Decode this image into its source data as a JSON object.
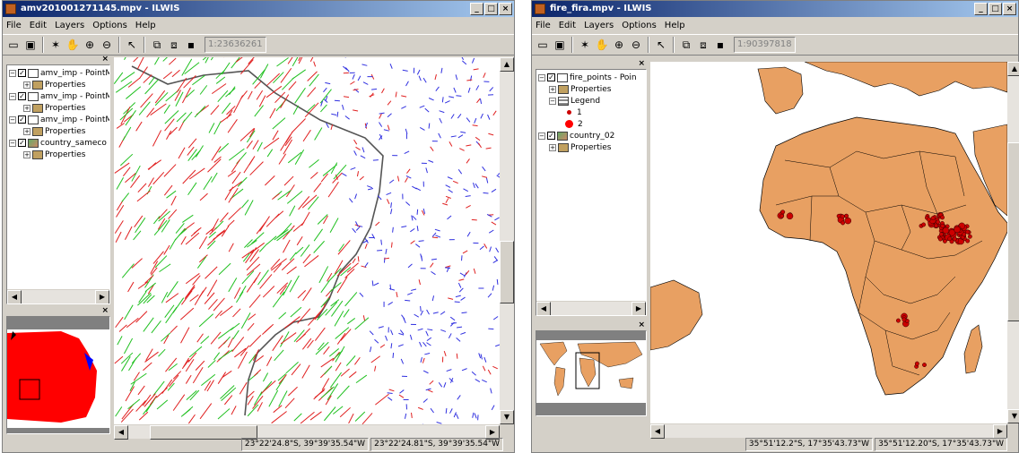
{
  "window1": {
    "title": "amv201001271145.mpv - ILWIS",
    "controls": {
      "minimize": "_",
      "maximize": "□",
      "close": "×"
    },
    "menu": [
      "File",
      "Edit",
      "Layers",
      "Options",
      "Help"
    ],
    "toolbar_icons": [
      "new-map-icon",
      "open-icon",
      "pointer-icon",
      "pan-icon",
      "zoom-in-icon",
      "zoom-out-icon",
      "select-icon",
      "layer-add-icon",
      "layer-remove-icon",
      "save-icon"
    ],
    "scale": "1:23636261",
    "layers": [
      {
        "name": "amv_imp - PointM",
        "child": "Properties"
      },
      {
        "name": "amv_imp - PointM",
        "child": "Properties"
      },
      {
        "name": "amv_imp - PointM",
        "child": "Properties"
      },
      {
        "name": "country_sameco",
        "child": "Properties"
      }
    ],
    "status": [
      "23°22'24.8\"S, 39°39'35.54\"W",
      "23°22'24.81\"S, 39°39'35.54\"W"
    ]
  },
  "window2": {
    "title": "fire_fira.mpv - ILWIS",
    "controls": {
      "minimize": "_",
      "maximize": "□",
      "close": "×"
    },
    "menu": [
      "File",
      "Edit",
      "Layers",
      "Options",
      "Help"
    ],
    "toolbar_icons": [
      "new-map-icon",
      "open-icon",
      "pointer-icon",
      "pan-icon",
      "zoom-in-icon",
      "zoom-out-icon",
      "select-icon",
      "layer-add-icon",
      "layer-remove-icon",
      "save-icon"
    ],
    "scale": "1:90397818",
    "layers": {
      "fire_points": "fire_points - Poin",
      "properties1": "Properties",
      "legend": "Legend",
      "legend_items": [
        "1",
        "2"
      ],
      "country": "country_02",
      "properties2": "Properties"
    },
    "status": [
      "35°51'12.2\"S, 17°35'43.73\"W",
      "35°51'12.20\"S, 17°35'43.73\"W"
    ],
    "colors": {
      "land": "#e8a062",
      "points": "#cc0000"
    }
  }
}
